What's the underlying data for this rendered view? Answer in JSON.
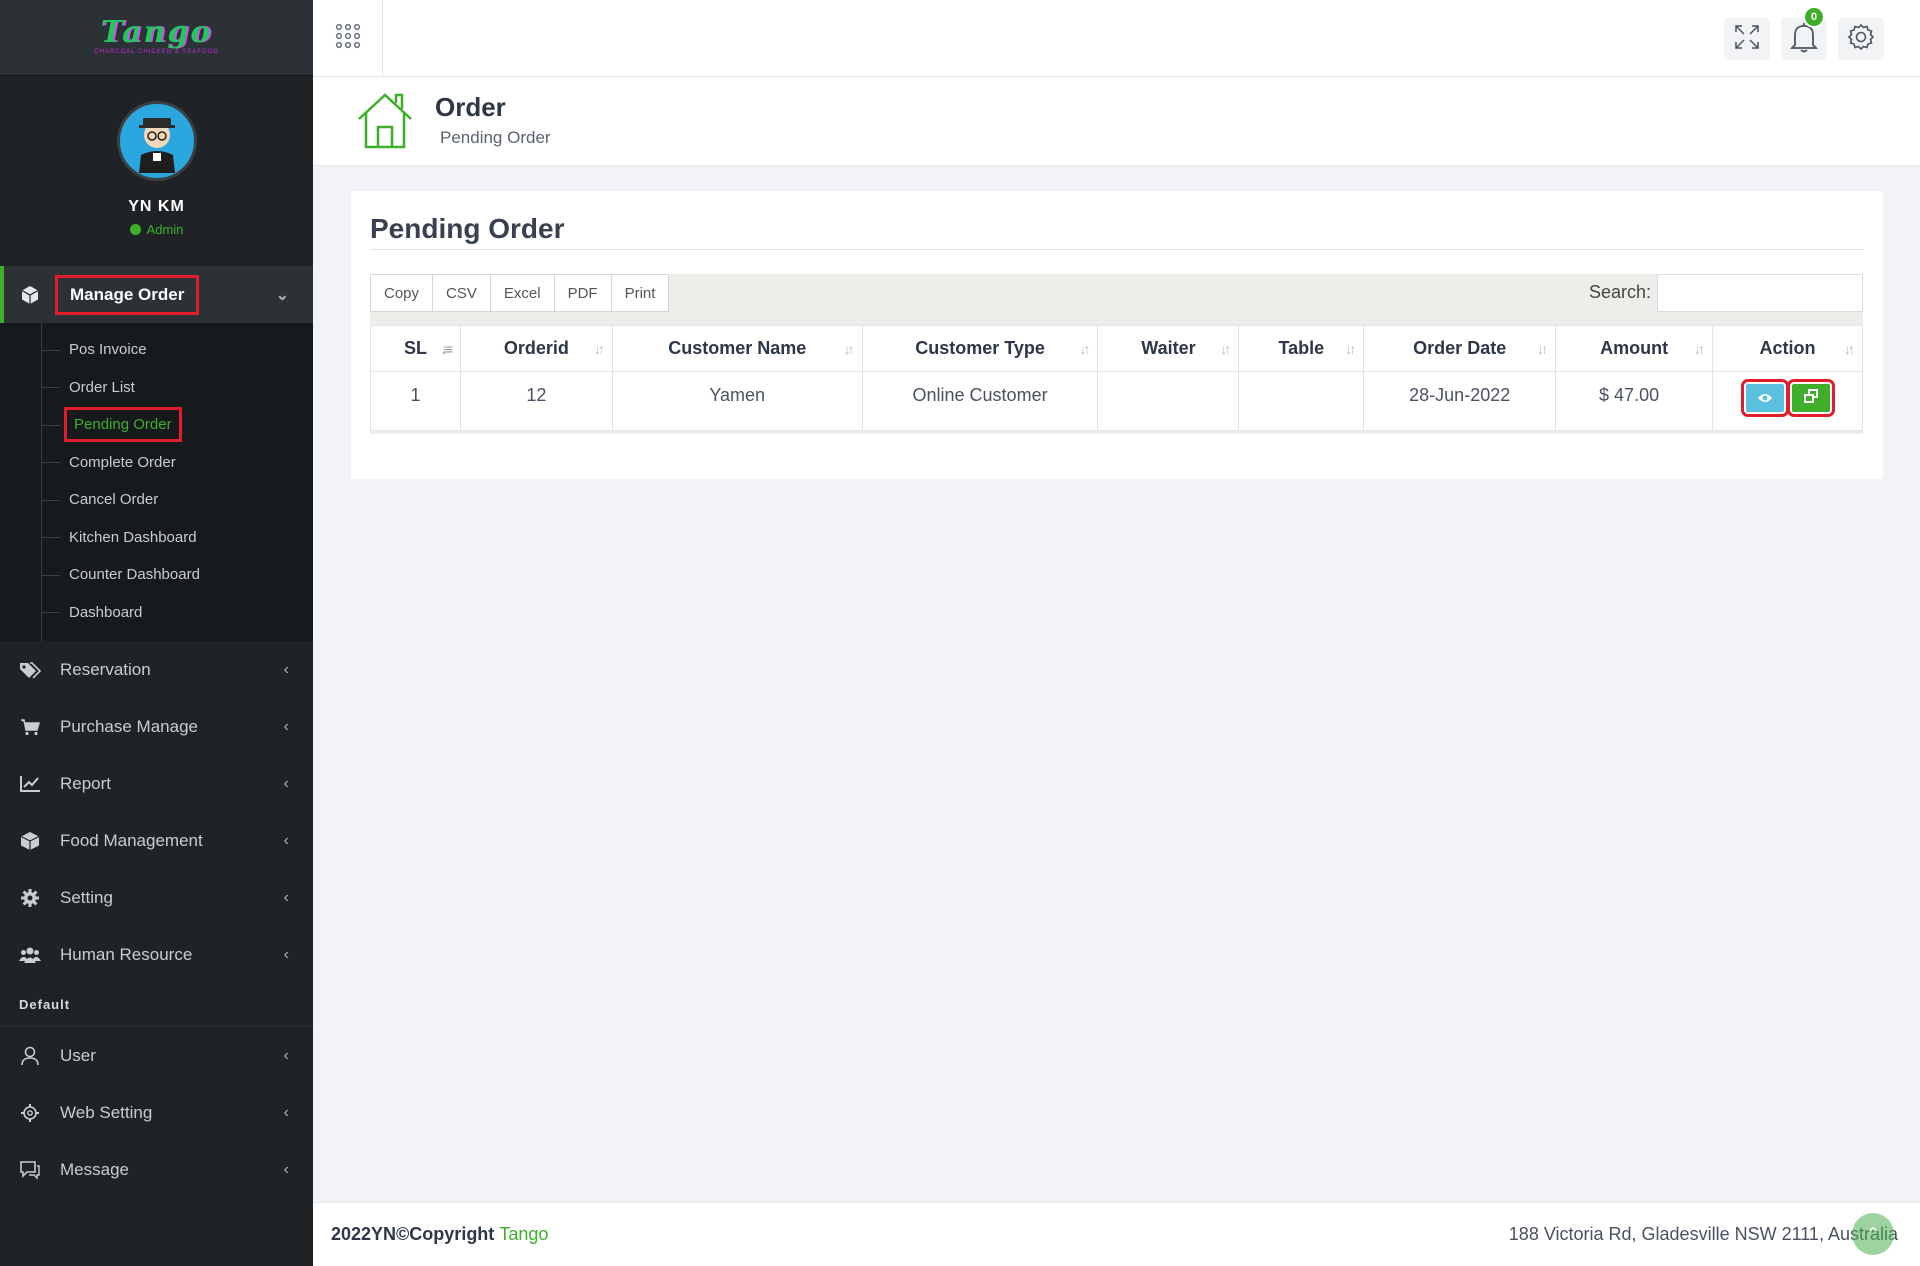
{
  "brand": {
    "name": "Tango",
    "tagline": "CHARCOAL CHICKEN & SEAFOOD"
  },
  "profile": {
    "name": "YN KM",
    "role": "Admin"
  },
  "sidebar": {
    "active_menu": "Manage Order",
    "submenu": [
      "Pos Invoice",
      "Order List",
      "Pending Order",
      "Complete Order",
      "Cancel Order",
      "Kitchen Dashboard",
      "Counter Dashboard",
      "Dashboard"
    ],
    "current_sub": "Pending Order",
    "menus": [
      "Reservation",
      "Purchase Manage",
      "Report",
      "Food Management",
      "Setting",
      "Human Resource"
    ],
    "section": "Default",
    "default_menus": [
      "User",
      "Web Setting",
      "Message"
    ]
  },
  "topbar": {
    "notification_count": "0"
  },
  "page_header": {
    "title": "Order",
    "subtitle": "Pending Order"
  },
  "panel": {
    "title": "Pending Order",
    "export_buttons": [
      "Copy",
      "CSV",
      "Excel",
      "PDF",
      "Print"
    ],
    "search_label": "Search:",
    "search_value": ""
  },
  "table": {
    "columns": [
      "SL",
      "Orderid",
      "Customer Name",
      "Customer Type",
      "Waiter",
      "Table",
      "Order Date",
      "Amount",
      "Action"
    ],
    "rows": [
      {
        "sl": "1",
        "orderid": "12",
        "customer_name": "Yamen",
        "customer_type": "Online Customer",
        "waiter": "",
        "table": "",
        "order_date": "28-Jun-2022",
        "amount": "$ 47.00"
      }
    ]
  },
  "footer": {
    "copyright": "2022YN©Copyright",
    "brand": "Tango",
    "address": "188 Victoria Rd, Gladesville NSW 2111, Australia"
  },
  "colors": {
    "accent": "#3fae2a",
    "highlight": "#e11d2b",
    "view_button": "#5bc0de",
    "sidebar_bg": "#1f2326"
  }
}
